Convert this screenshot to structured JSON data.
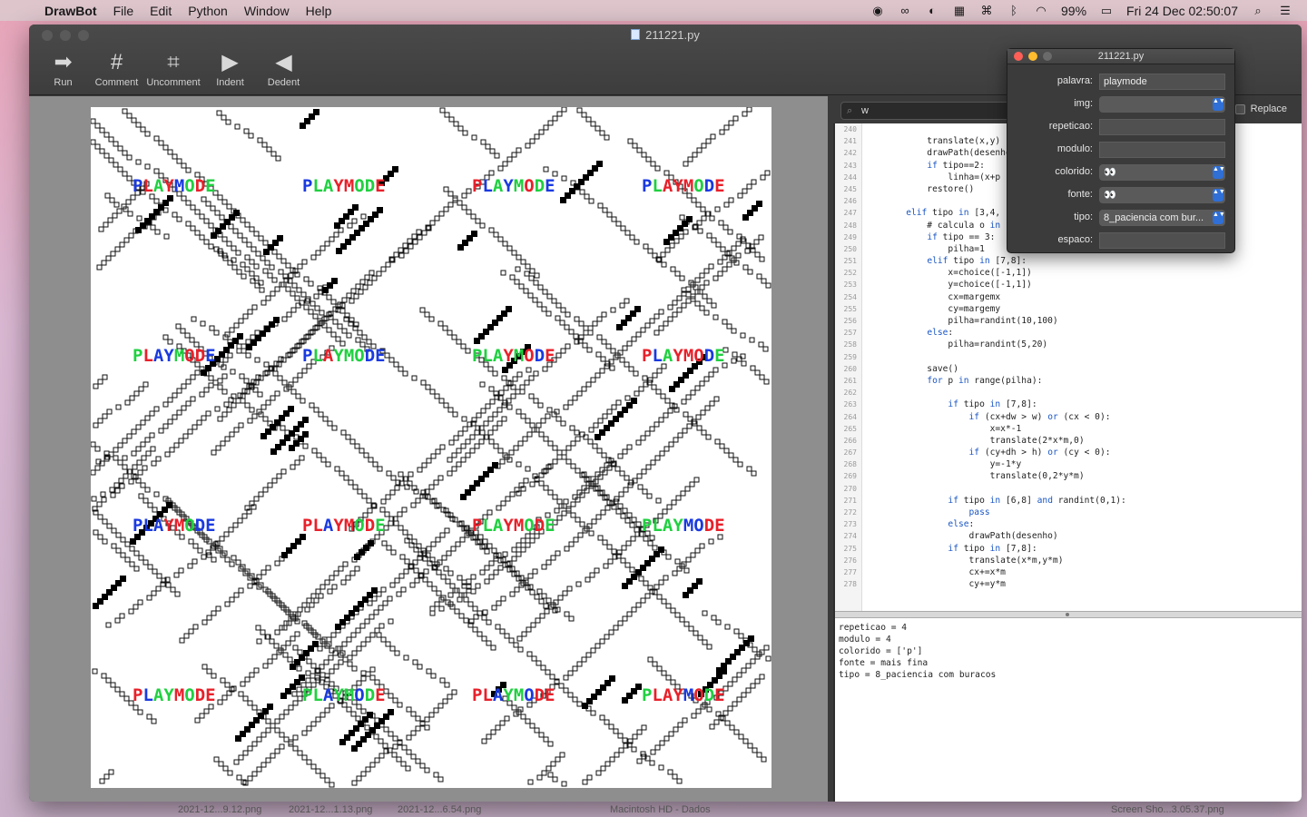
{
  "menubar": {
    "app": "DrawBot",
    "menus": [
      "File",
      "Edit",
      "Python",
      "Window",
      "Help"
    ],
    "battery": "99%",
    "clock": "Fri 24 Dec  02:50:07"
  },
  "window": {
    "title": "211221.py",
    "toolbar": [
      {
        "label": "Run",
        "icon": "run-arrow-icon",
        "glyph": "➡"
      },
      {
        "label": "Comment",
        "icon": "hash-icon",
        "glyph": "#"
      },
      {
        "label": "Uncomment",
        "icon": "uncomment-icon",
        "glyph": "⌗"
      },
      {
        "label": "Indent",
        "icon": "indent-icon",
        "glyph": "▶"
      },
      {
        "label": "Dedent",
        "icon": "dedent-icon",
        "glyph": "◀"
      }
    ]
  },
  "canvas": {
    "word": "PLAYMODE"
  },
  "find": {
    "value": "w",
    "replace_label": "Replace"
  },
  "editor": {
    "lines": [
      {
        "n": "240",
        "code": ""
      },
      {
        "n": "241",
        "code": "            translate(x,y)"
      },
      {
        "n": "242",
        "code": "            drawPath(desenho)"
      },
      {
        "n": "243",
        "code": "            if tipo==2:"
      },
      {
        "n": "244",
        "code": "                linha=(x+p"
      },
      {
        "n": "245",
        "code": "            restore()"
      },
      {
        "n": "246",
        "code": ""
      },
      {
        "n": "247",
        "code": "        elif tipo in [3,4,"
      },
      {
        "n": "248",
        "code": "            # calcula o in"
      },
      {
        "n": "249",
        "code": "            if tipo == 3:"
      },
      {
        "n": "250",
        "code": "                pilha=1"
      },
      {
        "n": "251",
        "code": "            elif tipo in [7,8]:"
      },
      {
        "n": "252",
        "code": "                x=choice([-1,1])"
      },
      {
        "n": "253",
        "code": "                y=choice([-1,1])"
      },
      {
        "n": "254",
        "code": "                cx=margemx"
      },
      {
        "n": "255",
        "code": "                cy=margemy"
      },
      {
        "n": "256",
        "code": "                pilha=randint(10,100)"
      },
      {
        "n": "257",
        "code": "            else:"
      },
      {
        "n": "258",
        "code": "                pilha=randint(5,20)"
      },
      {
        "n": "259",
        "code": ""
      },
      {
        "n": "260",
        "code": "            save()"
      },
      {
        "n": "261",
        "code": "            for p in range(pilha):"
      },
      {
        "n": "262",
        "code": ""
      },
      {
        "n": "263",
        "code": "                if tipo in [7,8]:"
      },
      {
        "n": "264",
        "code": "                    if (cx+dw > w) or (cx < 0):"
      },
      {
        "n": "265",
        "code": "                        x=x*-1"
      },
      {
        "n": "266",
        "code": "                        translate(2*x*m,0)"
      },
      {
        "n": "267",
        "code": "                    if (cy+dh > h) or (cy < 0):"
      },
      {
        "n": "268",
        "code": "                        y=-1*y"
      },
      {
        "n": "269",
        "code": "                        translate(0,2*y*m)"
      },
      {
        "n": "270",
        "code": ""
      },
      {
        "n": "271",
        "code": "                if tipo in [6,8] and randint(0,1):"
      },
      {
        "n": "272",
        "code": "                    pass"
      },
      {
        "n": "273",
        "code": "                else:"
      },
      {
        "n": "274",
        "code": "                    drawPath(desenho)"
      },
      {
        "n": "275",
        "code": "                if tipo in [7,8]:"
      },
      {
        "n": "276",
        "code": "                    translate(x*m,y*m)"
      },
      {
        "n": "277",
        "code": "                    cx+=x*m"
      },
      {
        "n": "278",
        "code": "                    cy+=y*m"
      }
    ]
  },
  "output": {
    "lines": [
      "repeticao = 4",
      "modulo = 4",
      "colorido = ['p']",
      "fonte = mais fina",
      "tipo = 8_paciencia com buracos"
    ]
  },
  "variables_panel": {
    "title": "211221.py",
    "fields": [
      {
        "label": "palavra:",
        "value": "playmode",
        "kind": "text"
      },
      {
        "label": "img:",
        "value": "",
        "kind": "popup"
      },
      {
        "label": "repeticao:",
        "value": "",
        "kind": "text"
      },
      {
        "label": "modulo:",
        "value": "",
        "kind": "text"
      },
      {
        "label": "colorido:",
        "value": "👀",
        "kind": "popup"
      },
      {
        "label": "fonte:",
        "value": "👀",
        "kind": "popup"
      },
      {
        "label": "tipo:",
        "value": "8_paciencia com bur...",
        "kind": "popup"
      },
      {
        "label": "espaco:",
        "value": "",
        "kind": "text"
      }
    ]
  },
  "dock": {
    "items": [
      "2021-12...9.12.png",
      "2021-12...1.13.png",
      "2021-12...6.54.png",
      "Macintosh HD - Dados",
      "Screen Sho...3.05.37.png"
    ]
  },
  "colors": {
    "red": "#e8202a",
    "green": "#20d040",
    "blue": "#1a3ae0"
  }
}
